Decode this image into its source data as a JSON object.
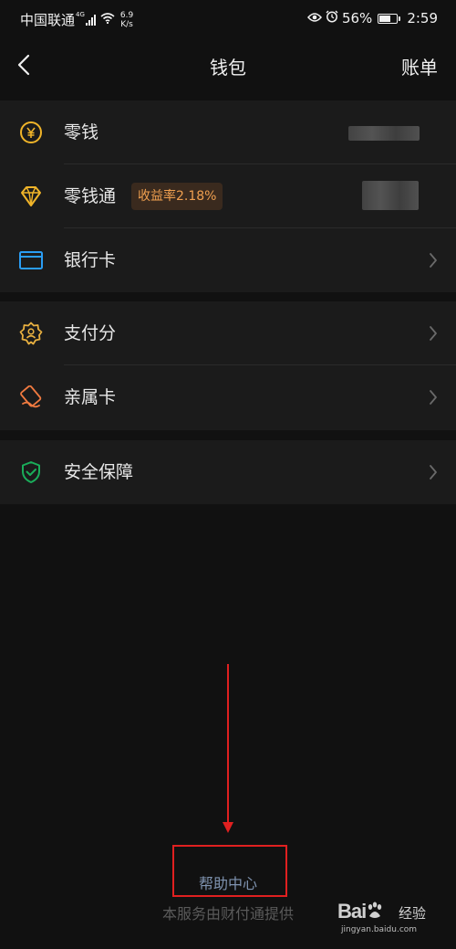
{
  "status_bar": {
    "carrier": "中国联通",
    "network": "4G",
    "speed_value": "6.9",
    "speed_unit": "K/s",
    "battery": "56%",
    "time": "2:59"
  },
  "nav": {
    "title": "钱包",
    "right_action": "账单"
  },
  "groups": [
    {
      "items": [
        {
          "label": "零钱",
          "icon": "yuan-coin-icon",
          "value_hidden": true
        },
        {
          "label": "零钱通",
          "icon": "diamond-icon",
          "badge": "收益率2.18%",
          "value_hidden": true
        },
        {
          "label": "银行卡",
          "icon": "bank-card-icon",
          "chevron": true
        }
      ]
    },
    {
      "items": [
        {
          "label": "支付分",
          "icon": "gear-person-icon",
          "chevron": true
        },
        {
          "label": "亲属卡",
          "icon": "family-card-icon",
          "chevron": true
        }
      ]
    },
    {
      "items": [
        {
          "label": "安全保障",
          "icon": "shield-check-icon",
          "chevron": true
        }
      ]
    }
  ],
  "help_center": "帮助中心",
  "footer": "本服务由财付通提供",
  "watermark": {
    "brand": "Bai",
    "brand_suffix": "du",
    "cn": "经验",
    "url": "jingyan.baidu.com"
  },
  "colors": {
    "background": "#111111",
    "card": "#1b1b1b",
    "coin_icon": "#f0b429",
    "bank_icon": "#2a9df4",
    "pay_score_icon": "#e8b040",
    "family_icon": "#f07a40",
    "security_icon": "#1aad5a",
    "badge_text": "#f0a050",
    "help_link": "#7f93b0",
    "annotation": "#e02020"
  }
}
